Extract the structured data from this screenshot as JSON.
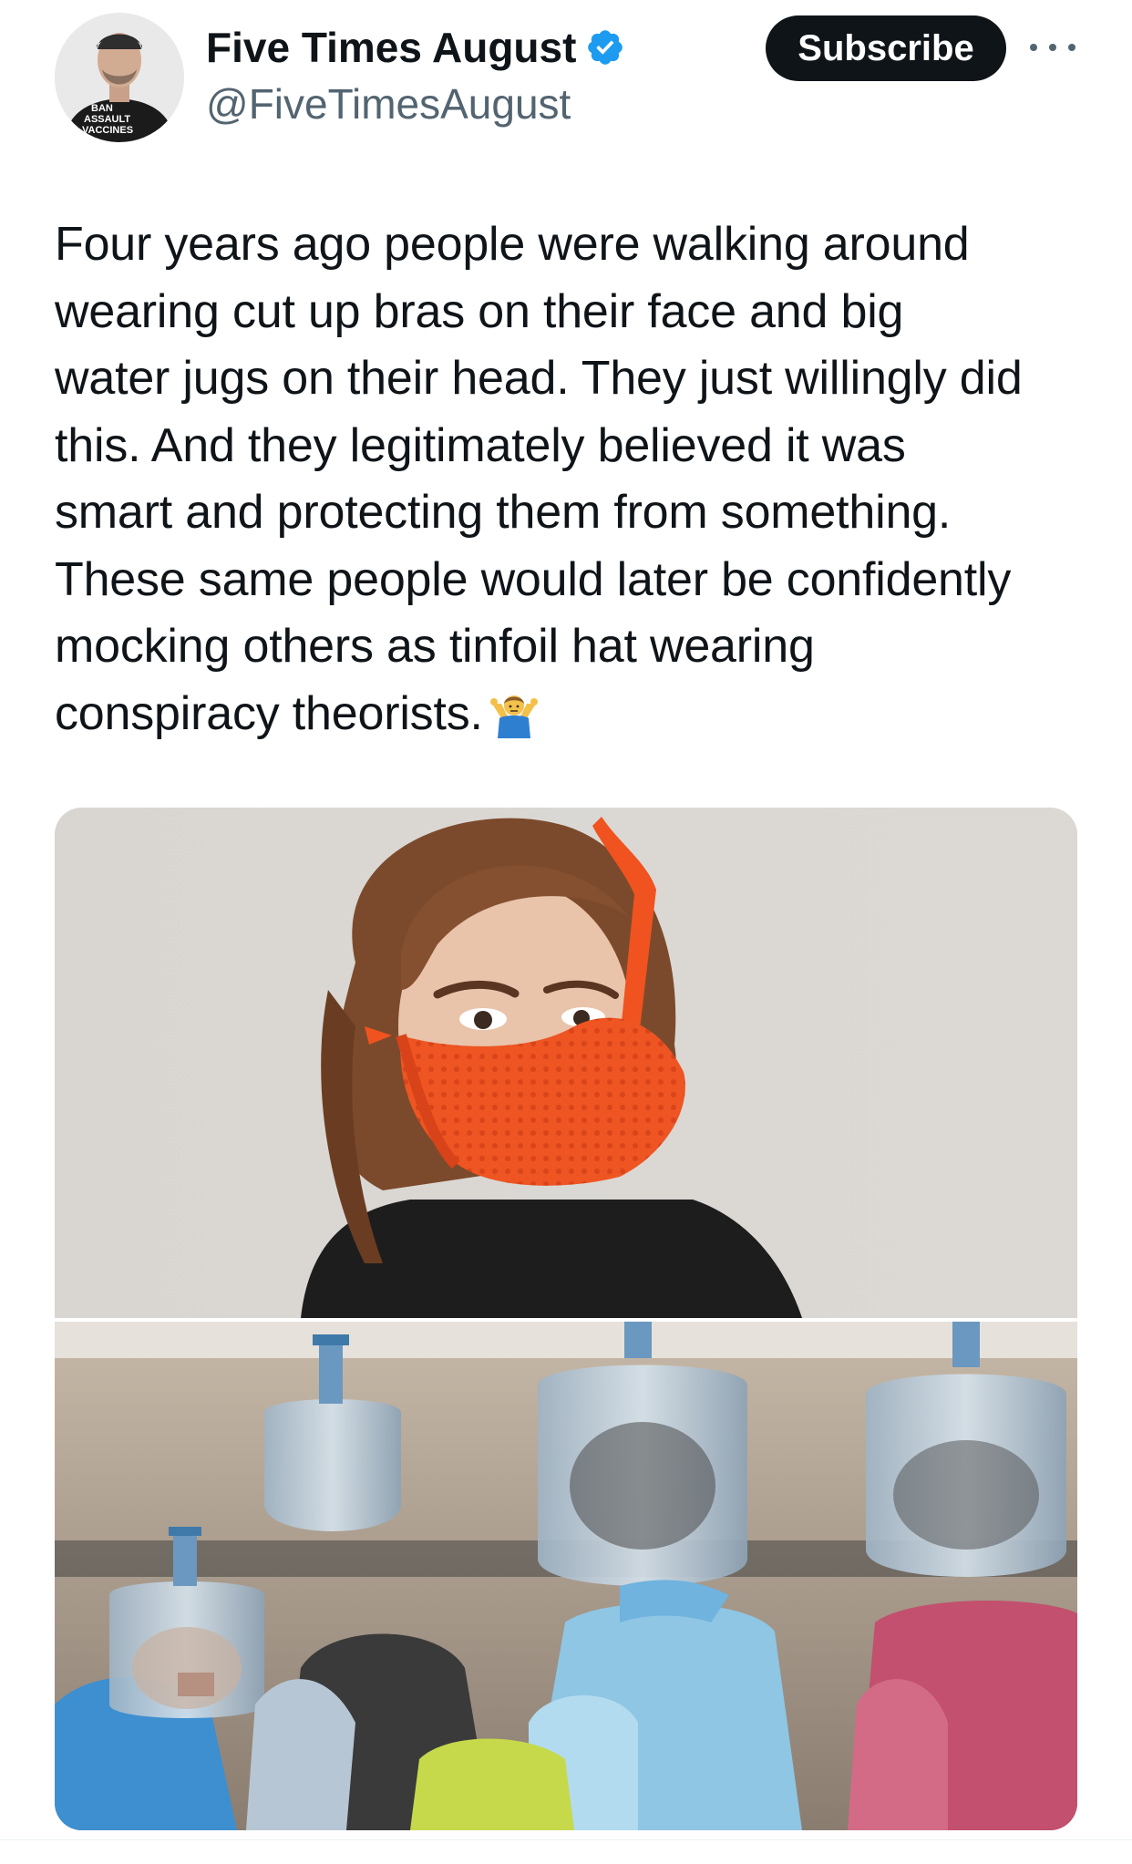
{
  "author": {
    "display_name": "Five Times August",
    "handle": "@FiveTimesAugust",
    "verified": true,
    "avatar_shirt_text": [
      "BAN",
      "ASSAULT",
      "VACCINES"
    ]
  },
  "actions": {
    "subscribe_label": "Subscribe",
    "more_icon": "more-horizontal-icon"
  },
  "post": {
    "lines": [
      "Four years ago people were walking around",
      "wearing cut up bras on their face and big",
      "water jugs on their head. They just willingly did",
      "this. And they legitimately believed it was",
      "smart and protecting them from something.",
      "These same people would later be confidently",
      "mocking others as tinfoil hat wearing",
      "conspiracy theorists."
    ],
    "trailing_emoji": "shrug-emoji"
  },
  "media": {
    "panels": [
      "woman-bra-face-mask-photo",
      "people-water-jug-helmets-photo"
    ]
  },
  "colors": {
    "text_primary": "#0f1419",
    "text_secondary": "#536471",
    "verified_blue": "#1d9bf0",
    "button_bg": "#0f1419",
    "mask_orange": "#f0531f"
  }
}
